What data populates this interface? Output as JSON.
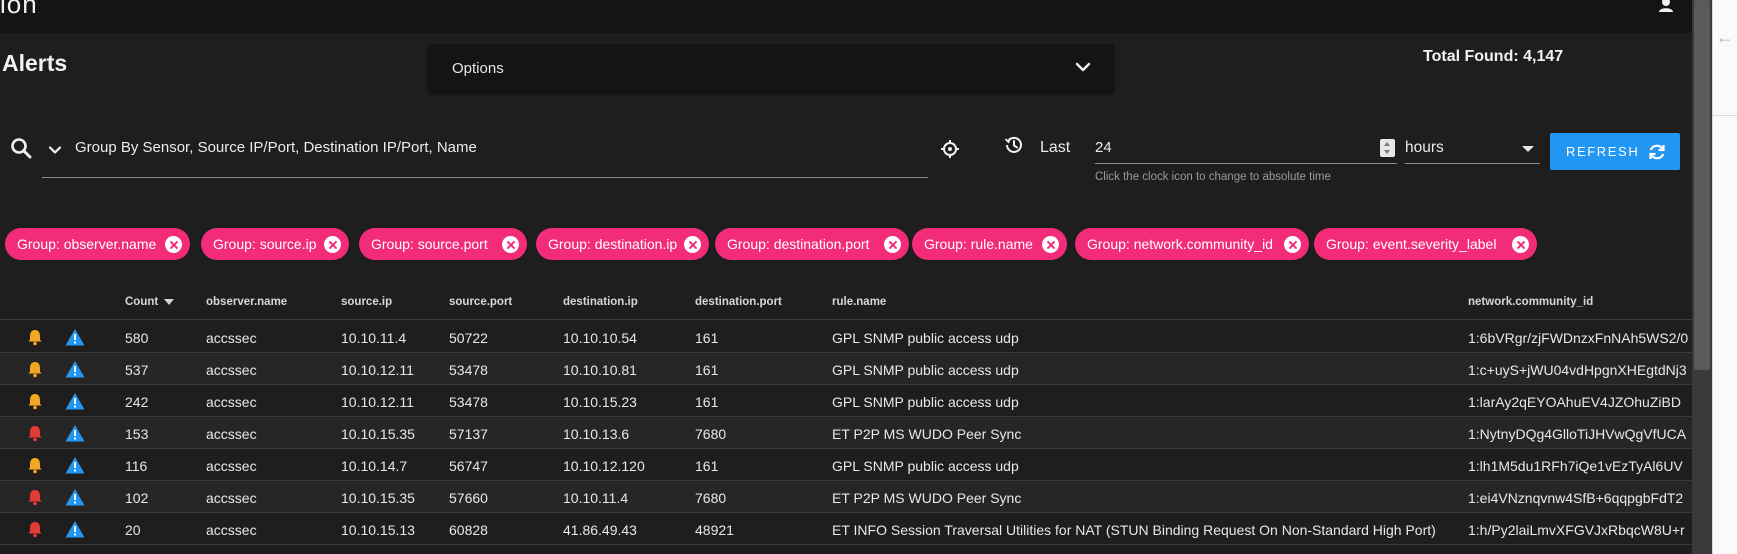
{
  "app": {
    "brand": "ion"
  },
  "page": {
    "title": "Alerts",
    "total_found": "Total Found: 4,147"
  },
  "options": {
    "label": "Options"
  },
  "search": {
    "query": "Group By Sensor, Source IP/Port, Destination IP/Port, Name"
  },
  "time": {
    "last_label": "Last",
    "value": "24",
    "unit": "hours",
    "hint": "Click the clock icon to change to absolute time",
    "refresh_label": "REFRESH"
  },
  "chips": [
    "Group: observer.name",
    "Group: source.ip",
    "Group: source.port",
    "Group: destination.ip",
    "Group: destination.port",
    "Group: rule.name",
    "Group: network.community_id",
    "Group: event.severity_label"
  ],
  "table": {
    "columns": [
      "Count",
      "observer.name",
      "source.ip",
      "source.port",
      "destination.ip",
      "destination.port",
      "rule.name",
      "network.community_id"
    ],
    "sorted_column": "Count",
    "rows": [
      {
        "severity_color": "#f5a623",
        "count": "580",
        "observer": "accssec",
        "src_ip": "10.10.11.4",
        "src_port": "50722",
        "dst_ip": "10.10.10.54",
        "dst_port": "161",
        "rule": "GPL SNMP public access udp",
        "community_id": "1:6bVRgr/zjFWDnzxFnNAh5WS2/0"
      },
      {
        "severity_color": "#f5a623",
        "count": "537",
        "observer": "accssec",
        "src_ip": "10.10.12.11",
        "src_port": "53478",
        "dst_ip": "10.10.10.81",
        "dst_port": "161",
        "rule": "GPL SNMP public access udp",
        "community_id": "1:c+uyS+jWU04vdHpgnXHEgtdNj3"
      },
      {
        "severity_color": "#f5a623",
        "count": "242",
        "observer": "accssec",
        "src_ip": "10.10.12.11",
        "src_port": "53478",
        "dst_ip": "10.10.15.23",
        "dst_port": "161",
        "rule": "GPL SNMP public access udp",
        "community_id": "1:larAy2qEYOAhuEV4JZOhuZiBD"
      },
      {
        "severity_color": "#e53935",
        "count": "153",
        "observer": "accssec",
        "src_ip": "10.10.15.35",
        "src_port": "57137",
        "dst_ip": "10.10.13.6",
        "dst_port": "7680",
        "rule": "ET P2P MS WUDO Peer Sync",
        "community_id": "1:NytnyDQg4GlloTiJHVwQgVfUCA"
      },
      {
        "severity_color": "#f5a623",
        "count": "116",
        "observer": "accssec",
        "src_ip": "10.10.14.7",
        "src_port": "56747",
        "dst_ip": "10.10.12.120",
        "dst_port": "161",
        "rule": "GPL SNMP public access udp",
        "community_id": "1:lh1M5du1RFh7iQe1vEzTyAl6UV"
      },
      {
        "severity_color": "#e53935",
        "count": "102",
        "observer": "accssec",
        "src_ip": "10.10.15.35",
        "src_port": "57660",
        "dst_ip": "10.10.11.4",
        "dst_port": "7680",
        "rule": "ET P2P MS WUDO Peer Sync",
        "community_id": "1:ei4VNznqvnw4SfB+6qqpgbFdT2"
      },
      {
        "severity_color": "#e53935",
        "count": "20",
        "observer": "accssec",
        "src_ip": "10.10.15.13",
        "src_port": "60828",
        "dst_ip": "41.86.49.43",
        "dst_port": "48921",
        "rule": "ET INFO Session Traversal Utilities for NAT (STUN Binding Request On Non-Standard High Port)",
        "community_id": "1:h/Py2laiLmvXFGVJxRbqcW8U+r"
      }
    ]
  },
  "colors": {
    "accent": "#2196f3",
    "chip": "#f22c79",
    "warning": "#f5a623",
    "critical": "#e53935",
    "info_icon": "#2196f3"
  }
}
